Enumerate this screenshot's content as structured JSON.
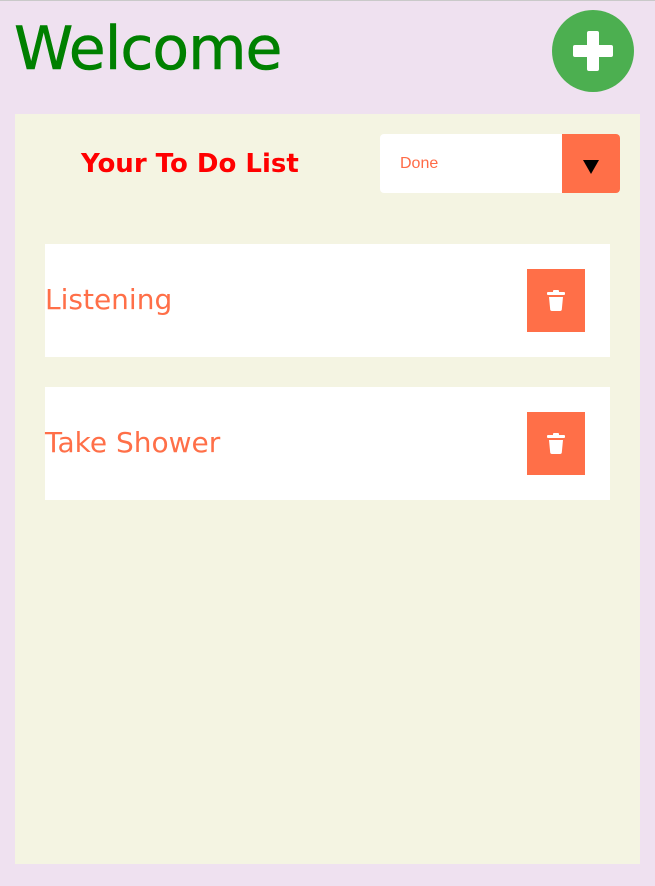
{
  "header": {
    "title": "Welcome",
    "add_icon": "plus-circle-icon"
  },
  "panel": {
    "title": "Your To Do List",
    "filter": {
      "selected": "Done",
      "arrow_icon": "caret-down-icon"
    },
    "items": [
      {
        "text": "Listening",
        "delete_icon": "trash-icon"
      },
      {
        "text": "Take Shower",
        "delete_icon": "trash-icon"
      }
    ]
  },
  "colors": {
    "page_background": "#efe1f0",
    "panel_background": "#f4f4e2",
    "title_green": "#008000",
    "add_button_green": "#4caf50",
    "list_title_red": "#ff0000",
    "accent_orange": "#ff6f48",
    "card_white": "#ffffff"
  }
}
